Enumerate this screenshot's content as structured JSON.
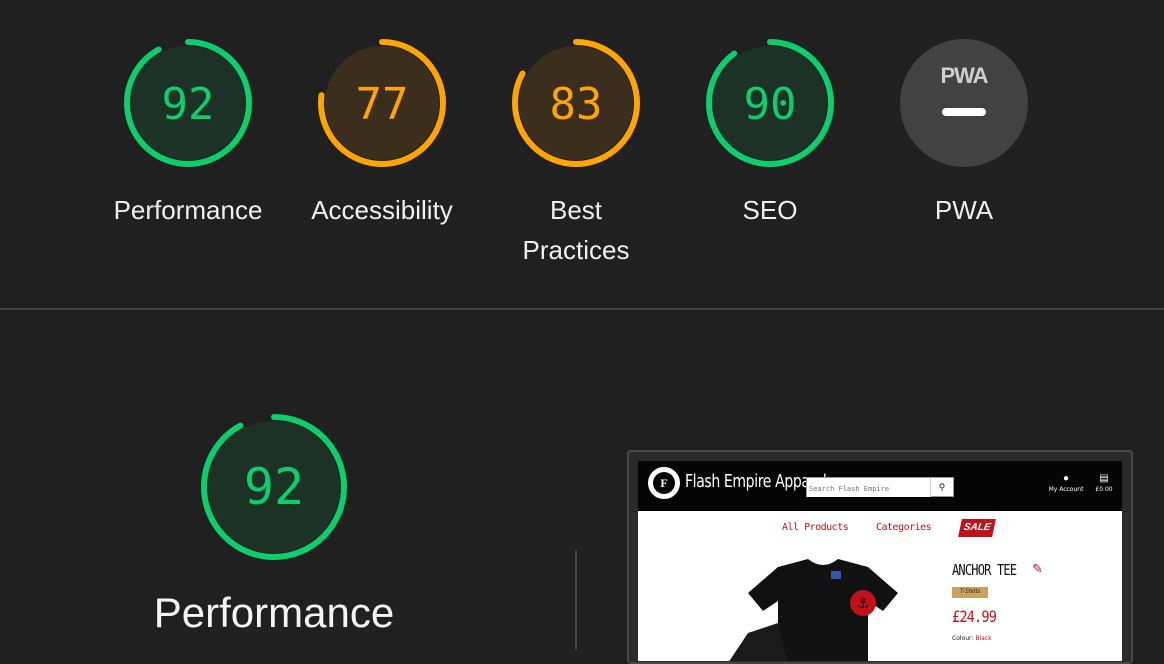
{
  "scores": [
    {
      "id": "performance",
      "label": "Performance",
      "value": "92",
      "score": 92,
      "status": "pass"
    },
    {
      "id": "accessibility",
      "label": "Accessibility",
      "value": "77",
      "score": 77,
      "status": "average"
    },
    {
      "id": "best-practices",
      "label": "Best Practices",
      "value": "83",
      "score": 83,
      "status": "average"
    },
    {
      "id": "seo",
      "label": "SEO",
      "value": "90",
      "score": 90,
      "status": "pass"
    },
    {
      "id": "pwa",
      "label": "PWA",
      "badge_text": "PWA",
      "status": "not-applicable"
    }
  ],
  "colors": {
    "pass": "#0cce6b",
    "pass_fill": "#1d3226",
    "average": "#ffa400",
    "average_fill": "#3b2e1d",
    "na": "#424242",
    "background": "#202020"
  },
  "detail": {
    "title": "Performance",
    "value": "92",
    "score": 92
  },
  "screenshot": {
    "brand": "Flash Empire Apparel",
    "logo_letter": "F",
    "search_placeholder": "Search Flash Empire",
    "account_label": "My Account",
    "cart_label": "£0.00",
    "nav": [
      "All Products",
      "Categories"
    ],
    "sale_label": "SALE",
    "product_name": "ANCHOR TEE",
    "product_tag": "T-Shirts",
    "price": "£24.99",
    "colour_label": "Colour:",
    "colour_value": "Black"
  }
}
